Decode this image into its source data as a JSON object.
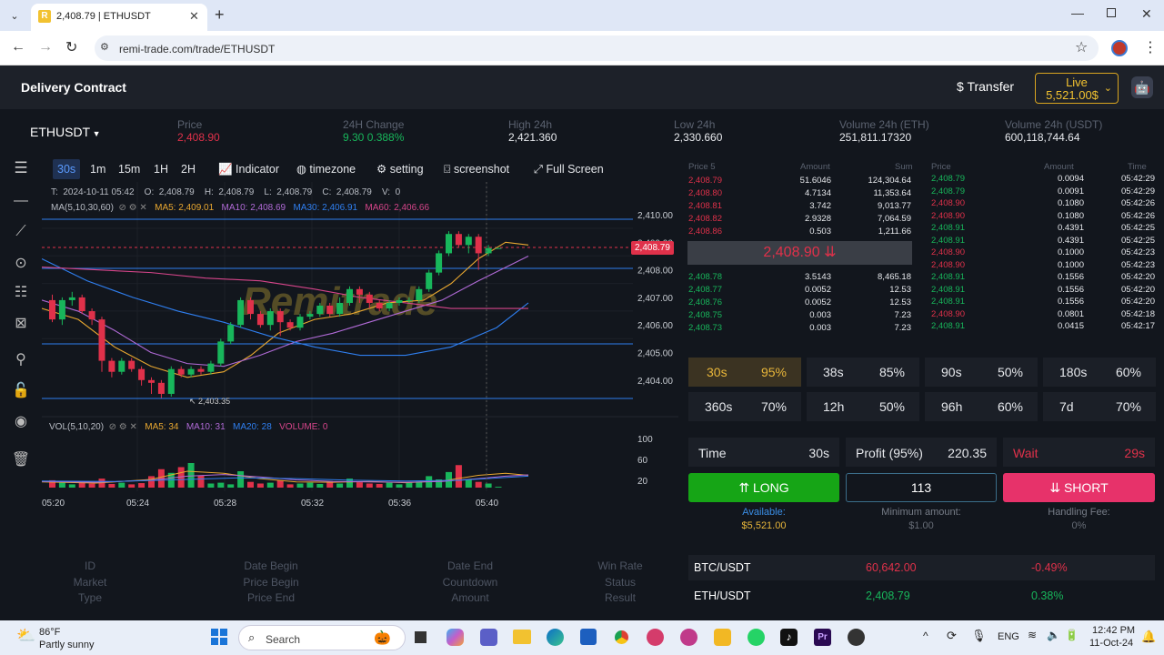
{
  "browser": {
    "tab_title": "2,408.79 | ETHUSDT",
    "url": "remi-trade.com/trade/ETHUSDT"
  },
  "header": {
    "title": "Delivery Contract",
    "transfer_label": "Transfer",
    "live_label": "Live",
    "live_balance": "5,521.00$"
  },
  "market": {
    "pair": "ETHUSDT",
    "price_label": "Price",
    "price": "2,408.90",
    "change_label": "24H Change",
    "change": "9.30 0.388%",
    "high_label": "High 24h",
    "high": "2,421.360",
    "low_label": "Low 24h",
    "low": "2,330.660",
    "vol_eth_label": "Volume 24h (ETH)",
    "vol_eth": "251,811.17320",
    "vol_usdt_label": "Volume 24h (USDT)",
    "vol_usdt": "600,118,744.64"
  },
  "toolbar": {
    "intervals": [
      "30s",
      "1m",
      "15m",
      "1H",
      "2H"
    ],
    "indicator": "Indicator",
    "timezone": "timezone",
    "setting": "setting",
    "screenshot": "screenshot",
    "fullscreen": "Full Screen"
  },
  "chart": {
    "ohlc": "T:  2024-10-11 05:42    O:  2,408.79    H:  2,408.79    L:  2,408.79    C:  2,408.79    V:  0",
    "ma_label": "MA(5,10,30,60)",
    "ma5": "MA5: 2,409.01",
    "ma10": "MA10: 2,408.69",
    "ma30": "MA30: 2,406.91",
    "ma60": "MA60: 2,406.66",
    "price_ticks": [
      "2,410.00",
      "2,409.00",
      "2,408.00",
      "2,407.00",
      "2,406.00",
      "2,405.00",
      "2,404.00"
    ],
    "last_price": "2,408.79",
    "low_mark": "2,403.35",
    "watermark": "Remitrade",
    "vol_label": "VOL(5,10,20)",
    "vma5": "MA5: 34",
    "vma10": "MA10: 31",
    "vma20": "MA20: 28",
    "vvol": "VOLUME: 0",
    "vol_ticks": [
      "100",
      "60",
      "20"
    ],
    "time_ticks": [
      "05:20",
      "05:24",
      "05:28",
      "05:32",
      "05:36",
      "05:40"
    ],
    "colors": {
      "up": "#18b65b",
      "down": "#e0314a",
      "ma5": "#e8a730",
      "ma10": "#b06ad6",
      "ma30": "#2f7ff0",
      "ma60": "#d6458a"
    }
  },
  "orderbook": {
    "h_price": "Price 5",
    "h_amount": "Amount",
    "h_sum": "Sum",
    "asks": [
      [
        "2,408.79",
        "51.6046",
        "124,304.64"
      ],
      [
        "2,408.80",
        "4.7134",
        "11,353.64"
      ],
      [
        "2,408.81",
        "3.742",
        "9,013.77"
      ],
      [
        "2,408.82",
        "2.9328",
        "7,064.59"
      ],
      [
        "2,408.86",
        "0.503",
        "1,211.66"
      ]
    ],
    "mid": "2,408.90",
    "bids": [
      [
        "2,408.78",
        "3.5143",
        "8,465.18"
      ],
      [
        "2,408.77",
        "0.0052",
        "12.53"
      ],
      [
        "2,408.76",
        "0.0052",
        "12.53"
      ],
      [
        "2,408.75",
        "0.003",
        "7.23"
      ],
      [
        "2,408.73",
        "0.003",
        "7.23"
      ]
    ]
  },
  "trades": {
    "h_price": "Price",
    "h_amount": "Amount",
    "h_time": "Time",
    "rows": [
      [
        "2,408.79",
        "0.0094",
        "05:42:29",
        "g"
      ],
      [
        "2,408.79",
        "0.0091",
        "05:42:29",
        "g"
      ],
      [
        "2,408.90",
        "0.1080",
        "05:42:26",
        "r"
      ],
      [
        "2,408.90",
        "0.1080",
        "05:42:26",
        "r"
      ],
      [
        "2,408.91",
        "0.4391",
        "05:42:25",
        "g"
      ],
      [
        "2,408.91",
        "0.4391",
        "05:42:25",
        "g"
      ],
      [
        "2,408.90",
        "0.1000",
        "05:42:23",
        "r"
      ],
      [
        "2,408.90",
        "0.1000",
        "05:42:23",
        "r"
      ],
      [
        "2,408.91",
        "0.1556",
        "05:42:20",
        "g"
      ],
      [
        "2,408.91",
        "0.1556",
        "05:42:20",
        "g"
      ],
      [
        "2,408.91",
        "0.1556",
        "05:42:20",
        "g"
      ],
      [
        "2,408.90",
        "0.0801",
        "05:42:18",
        "r"
      ],
      [
        "2,408.91",
        "0.0415",
        "05:42:17",
        "g"
      ]
    ]
  },
  "durations": [
    [
      "30s",
      "95%"
    ],
    [
      "38s",
      "85%"
    ],
    [
      "90s",
      "50%"
    ],
    [
      "180s",
      "60%"
    ],
    [
      "360s",
      "70%"
    ],
    [
      "12h",
      "50%"
    ],
    [
      "96h",
      "60%"
    ],
    [
      "7d",
      "70%"
    ]
  ],
  "order": {
    "time_label": "Time",
    "time_value": "30s",
    "profit_label": "Profit (95%)",
    "profit_value": "220.35",
    "wait_label": "Wait",
    "wait_value": "29s",
    "long_label": "LONG",
    "amount": "113",
    "short_label": "SHORT",
    "available_label": "Available:",
    "available_value": "$5,521.00",
    "min_label": "Minimum amount:",
    "min_value": "$1.00",
    "fee_label": "Handling Fee:",
    "fee_value": "0%"
  },
  "pairs": [
    {
      "name": "BTC/USDT",
      "price": "60,642.00",
      "change": "-0.49%"
    },
    {
      "name": "ETH/USDT",
      "price": "2,408.79",
      "change": "0.38%"
    }
  ],
  "history": {
    "c1": [
      "ID",
      "Market",
      "Type"
    ],
    "c2": [
      "Date Begin",
      "Price Begin",
      "Price End"
    ],
    "c3": [
      "Date End",
      "Countdown",
      "Amount"
    ],
    "c4": [
      "Win Rate",
      "Status",
      "Result"
    ]
  },
  "taskbar": {
    "temp": "86°F",
    "weather": "Partly sunny",
    "search": "Search",
    "lang": "ENG",
    "time": "12:42 PM",
    "date": "11-Oct-24"
  }
}
